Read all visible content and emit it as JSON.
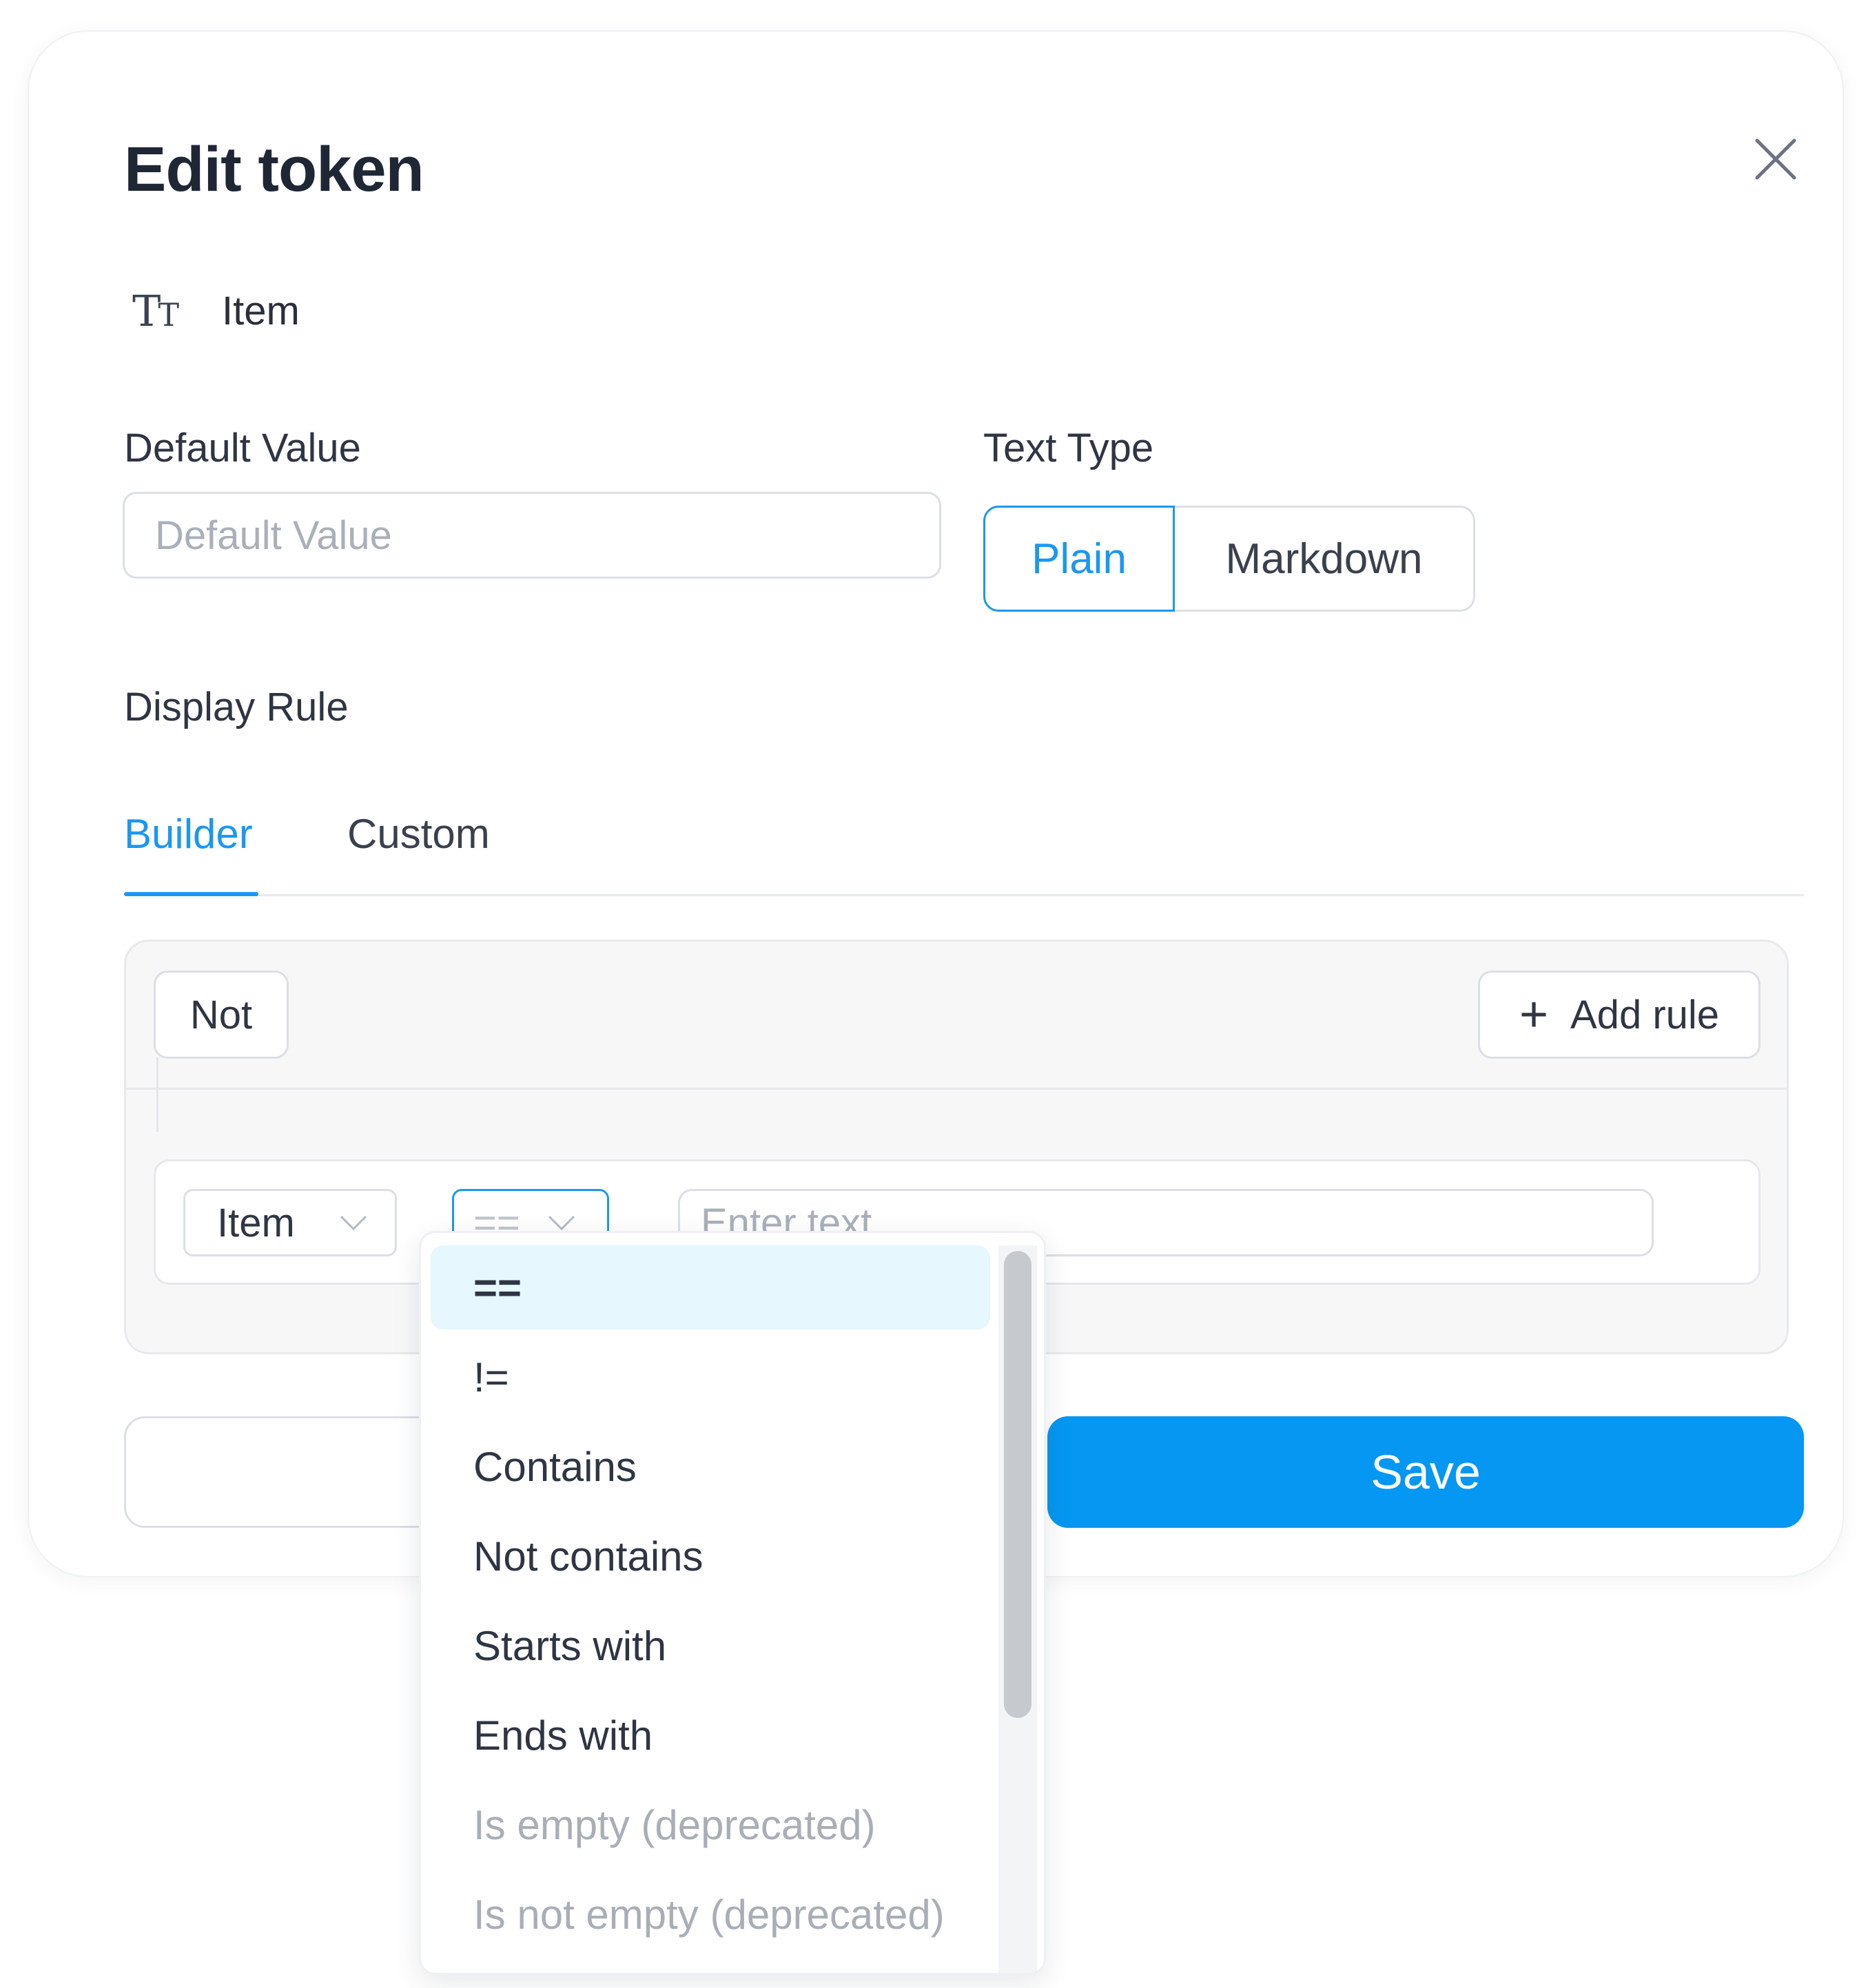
{
  "modal": {
    "title": "Edit token",
    "token": {
      "icon": "text-type-icon",
      "name": "Item"
    },
    "default_value": {
      "label": "Default Value",
      "placeholder": "Default Value",
      "value": ""
    },
    "text_type": {
      "label": "Text Type",
      "options": [
        "Plain",
        "Markdown"
      ],
      "selected": "Plain"
    },
    "display_rule": {
      "label": "Display Rule",
      "tabs": [
        {
          "label": "Builder",
          "active": true
        },
        {
          "label": "Custom",
          "active": false
        }
      ],
      "not_label": "Not",
      "add_rule_label": "Add rule",
      "rule": {
        "field": "Item",
        "operator": "==",
        "value_placeholder": "Enter text",
        "value": ""
      }
    },
    "footer": {
      "cancel_label": "",
      "save_label": "Save"
    }
  },
  "operator_dropdown": {
    "items": [
      {
        "label": "==",
        "active": true,
        "disabled": false
      },
      {
        "label": "!=",
        "active": false,
        "disabled": false
      },
      {
        "label": "Contains",
        "active": false,
        "disabled": false
      },
      {
        "label": "Not contains",
        "active": false,
        "disabled": false
      },
      {
        "label": "Starts with",
        "active": false,
        "disabled": false
      },
      {
        "label": "Ends with",
        "active": false,
        "disabled": false
      },
      {
        "label": "Is empty (deprecated)",
        "active": false,
        "disabled": true
      },
      {
        "label": "Is not empty (deprecated)",
        "active": false,
        "disabled": true
      }
    ]
  },
  "colors": {
    "accent": "#1b97f2",
    "save_button": "#0597f2",
    "active_option_bg": "#e6f7fd",
    "disabled_text": "#a9aeb6"
  }
}
